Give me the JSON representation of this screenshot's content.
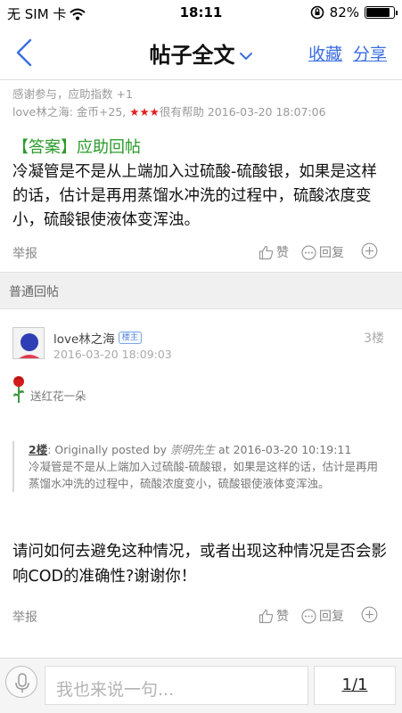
{
  "status_bar": {
    "carrier": "无 SIM 卡",
    "time": "18:11",
    "battery": "82%",
    "icons": [
      "wifi-icon",
      "rotation-lock-icon",
      "battery-icon"
    ]
  },
  "nav": {
    "title": "帖子全文",
    "favorite": "收藏",
    "share": "分享",
    "accent_color": "#3a6ee0"
  },
  "rating": {
    "line1": "感谢参与，应助指数 +1",
    "line2_prefix": "love林之海: 金币+25, ",
    "stars": "★★★",
    "line2_suffix": "很有帮助 2016-03-20 18:07:06"
  },
  "answer": {
    "title": "【答案】应助回帖",
    "text": "冷凝管是不是从上端加入过硫酸-硫酸银，如果是这样的话，估计是再用蒸馏水冲洗的过程中，硫酸浓度变小，硫酸银使液体变浑浊。"
  },
  "actions": {
    "report": "举报",
    "like": "赞",
    "reply": "回复"
  },
  "section": {
    "title": "普通回帖"
  },
  "post": {
    "username": "love林之海",
    "badge": "楼主",
    "floor": "3楼",
    "date": "2016-03-20 18:09:03",
    "flower": "送红花一朵",
    "quote_floor": "2楼",
    "quote_by": ": Originally posted by ",
    "quote_author": "崇明先生",
    "quote_at": " at 2016-03-20 10:19:11",
    "quote_text": "冷凝管是不是从上端加入过硫酸-硫酸银，如果是这样的话，估计是再用蒸馏水冲洗的过程中，硫酸浓度变小，硫酸银使液体变浑浊。",
    "text": "请问如何去避免这种情况，或者出现这种情况是否会影响COD的准确性?谢谢你！"
  },
  "bottom": {
    "placeholder": "我也来说一句...",
    "page": "1/1"
  }
}
